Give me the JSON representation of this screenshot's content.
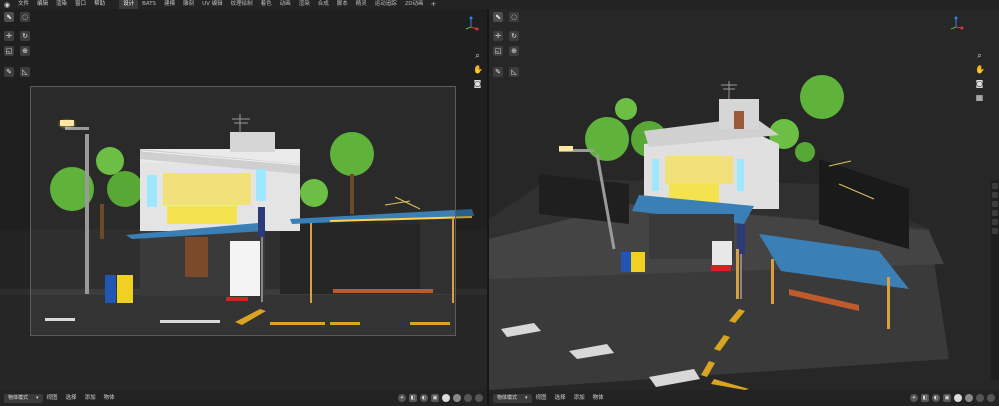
{
  "topbar": {
    "menus": [
      "文件",
      "编辑",
      "渲染",
      "窗口",
      "帮助"
    ],
    "workspaces": [
      {
        "label": "设计",
        "active": true
      },
      {
        "label": "BATS",
        "active": false
      },
      {
        "label": "建模",
        "active": false
      },
      {
        "label": "雕刻",
        "active": false
      },
      {
        "label": "UV 编辑",
        "active": false
      },
      {
        "label": "纹理绘制",
        "active": false
      },
      {
        "label": "着色",
        "active": false
      },
      {
        "label": "动画",
        "active": false
      },
      {
        "label": "渲染",
        "active": false
      },
      {
        "label": "合成",
        "active": false
      },
      {
        "label": "脚本",
        "active": false
      },
      {
        "label": "精灵",
        "active": false
      },
      {
        "label": "运动追踪",
        "active": false
      },
      {
        "label": "2D动画",
        "active": false
      }
    ],
    "add_symbol": "+"
  },
  "left_bottombar": {
    "mode": "物体模式",
    "menus": [
      "视图",
      "选择",
      "添加",
      "物体"
    ]
  },
  "right_bottombar": {
    "mode": "物体模式",
    "menus": [
      "视图",
      "选择",
      "添加",
      "物体"
    ]
  },
  "colors": {
    "sign_yellow": "#f2e07a",
    "glow": "#ffd24a",
    "roof_blue": "#3a7fb6",
    "tree_green": "#5fb23a",
    "road": "#343434",
    "bench": "#c05a2a"
  }
}
